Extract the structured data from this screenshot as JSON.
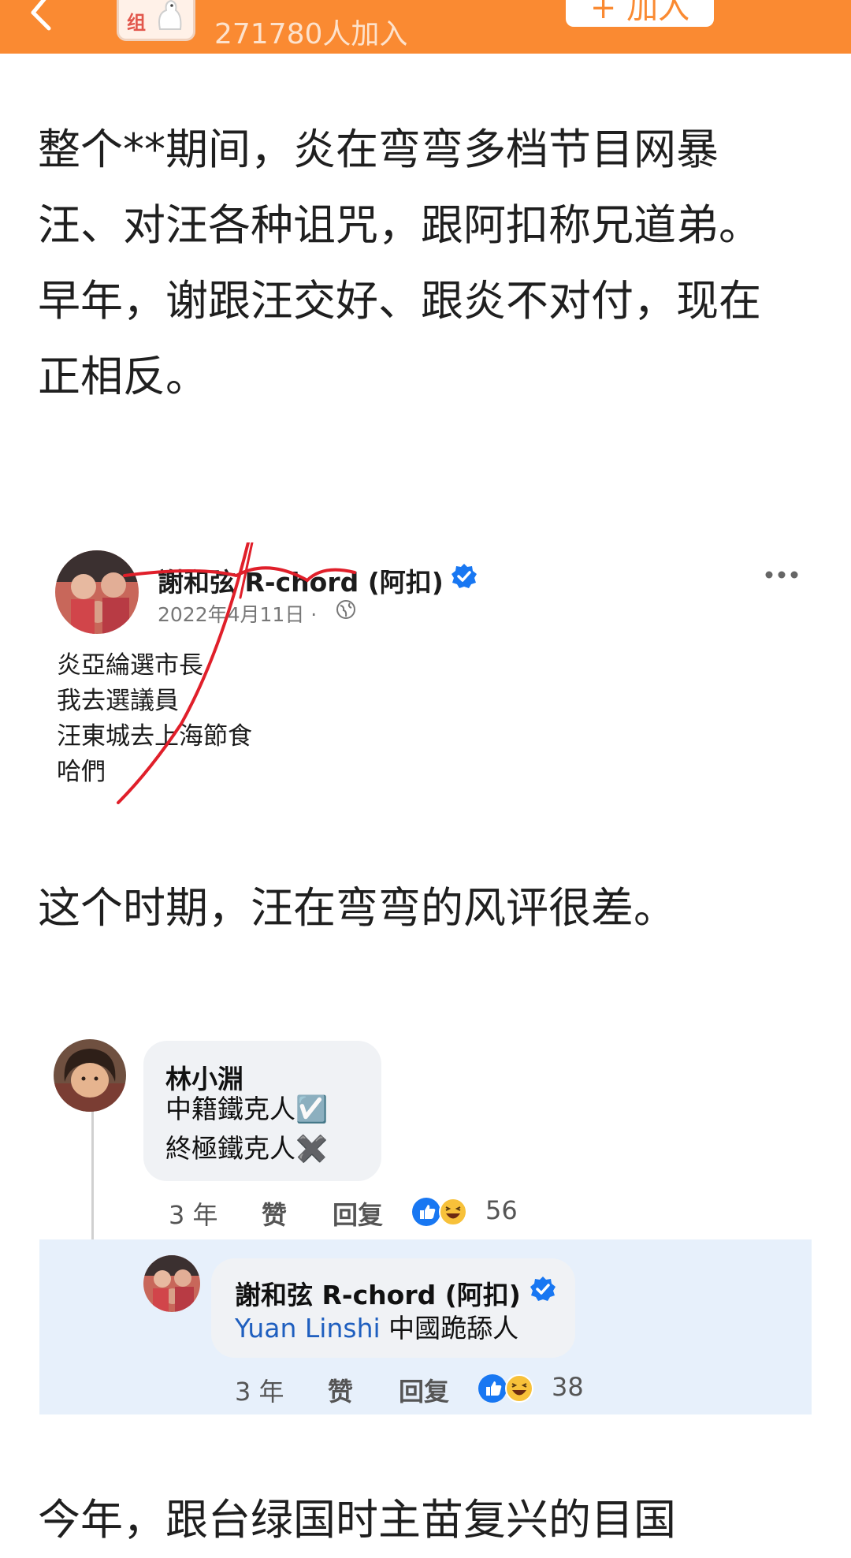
{
  "header": {
    "group_logo_text": "组",
    "member_count": "271780人加入",
    "join_label": "+ 加入"
  },
  "article": {
    "para1": "整个**期间，炎在弯弯多档节目网暴汪、对汪各种诅咒，跟阿扣称兄道弟。早年，谢跟汪交好、跟炎不对付，现在正相反。",
    "para2": "这个时期，汪在弯弯的风评很差。",
    "para3": "今年，跟台绿国时主苗复兴的目国"
  },
  "fb_post": {
    "author": "謝和弦 R-chord (阿扣)",
    "date": "2022年4月11日 ·",
    "lines": [
      "炎亞綸選市長",
      "我去選議員",
      "汪東城去上海節食",
      "哈們"
    ]
  },
  "comments": [
    {
      "author": "林小淵",
      "lines": [
        "中籍鐵克人☑️",
        "終極鐵克人✖️"
      ],
      "time": "3 年",
      "like_label": "赞",
      "reply_label": "回复",
      "reaction_count": "56"
    },
    {
      "author": "謝和弦 R-chord (阿扣)",
      "mention": "Yuan Linshi",
      "text": " 中國跪舔人",
      "time": "3 年",
      "like_label": "赞",
      "reply_label": "回复",
      "reaction_count": "38"
    }
  ],
  "colors": {
    "header_orange": "#fa8a32",
    "facebook_blue": "#1877f2",
    "highlight": "#e7f0fb",
    "annotation_red": "#e01f2a"
  }
}
